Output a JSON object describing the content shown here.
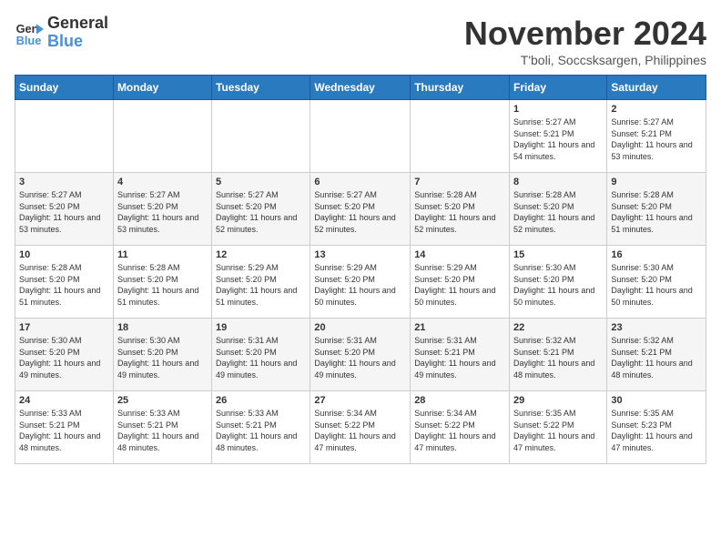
{
  "header": {
    "logo_line1": "General",
    "logo_line2": "Blue",
    "month_title": "November 2024",
    "location": "T'boli, Soccsksargen, Philippines"
  },
  "days_of_week": [
    "Sunday",
    "Monday",
    "Tuesday",
    "Wednesday",
    "Thursday",
    "Friday",
    "Saturday"
  ],
  "weeks": [
    [
      {
        "day": "",
        "info": ""
      },
      {
        "day": "",
        "info": ""
      },
      {
        "day": "",
        "info": ""
      },
      {
        "day": "",
        "info": ""
      },
      {
        "day": "",
        "info": ""
      },
      {
        "day": "1",
        "info": "Sunrise: 5:27 AM\nSunset: 5:21 PM\nDaylight: 11 hours and 54 minutes."
      },
      {
        "day": "2",
        "info": "Sunrise: 5:27 AM\nSunset: 5:21 PM\nDaylight: 11 hours and 53 minutes."
      }
    ],
    [
      {
        "day": "3",
        "info": "Sunrise: 5:27 AM\nSunset: 5:20 PM\nDaylight: 11 hours and 53 minutes."
      },
      {
        "day": "4",
        "info": "Sunrise: 5:27 AM\nSunset: 5:20 PM\nDaylight: 11 hours and 53 minutes."
      },
      {
        "day": "5",
        "info": "Sunrise: 5:27 AM\nSunset: 5:20 PM\nDaylight: 11 hours and 52 minutes."
      },
      {
        "day": "6",
        "info": "Sunrise: 5:27 AM\nSunset: 5:20 PM\nDaylight: 11 hours and 52 minutes."
      },
      {
        "day": "7",
        "info": "Sunrise: 5:28 AM\nSunset: 5:20 PM\nDaylight: 11 hours and 52 minutes."
      },
      {
        "day": "8",
        "info": "Sunrise: 5:28 AM\nSunset: 5:20 PM\nDaylight: 11 hours and 52 minutes."
      },
      {
        "day": "9",
        "info": "Sunrise: 5:28 AM\nSunset: 5:20 PM\nDaylight: 11 hours and 51 minutes."
      }
    ],
    [
      {
        "day": "10",
        "info": "Sunrise: 5:28 AM\nSunset: 5:20 PM\nDaylight: 11 hours and 51 minutes."
      },
      {
        "day": "11",
        "info": "Sunrise: 5:28 AM\nSunset: 5:20 PM\nDaylight: 11 hours and 51 minutes."
      },
      {
        "day": "12",
        "info": "Sunrise: 5:29 AM\nSunset: 5:20 PM\nDaylight: 11 hours and 51 minutes."
      },
      {
        "day": "13",
        "info": "Sunrise: 5:29 AM\nSunset: 5:20 PM\nDaylight: 11 hours and 50 minutes."
      },
      {
        "day": "14",
        "info": "Sunrise: 5:29 AM\nSunset: 5:20 PM\nDaylight: 11 hours and 50 minutes."
      },
      {
        "day": "15",
        "info": "Sunrise: 5:30 AM\nSunset: 5:20 PM\nDaylight: 11 hours and 50 minutes."
      },
      {
        "day": "16",
        "info": "Sunrise: 5:30 AM\nSunset: 5:20 PM\nDaylight: 11 hours and 50 minutes."
      }
    ],
    [
      {
        "day": "17",
        "info": "Sunrise: 5:30 AM\nSunset: 5:20 PM\nDaylight: 11 hours and 49 minutes."
      },
      {
        "day": "18",
        "info": "Sunrise: 5:30 AM\nSunset: 5:20 PM\nDaylight: 11 hours and 49 minutes."
      },
      {
        "day": "19",
        "info": "Sunrise: 5:31 AM\nSunset: 5:20 PM\nDaylight: 11 hours and 49 minutes."
      },
      {
        "day": "20",
        "info": "Sunrise: 5:31 AM\nSunset: 5:20 PM\nDaylight: 11 hours and 49 minutes."
      },
      {
        "day": "21",
        "info": "Sunrise: 5:31 AM\nSunset: 5:21 PM\nDaylight: 11 hours and 49 minutes."
      },
      {
        "day": "22",
        "info": "Sunrise: 5:32 AM\nSunset: 5:21 PM\nDaylight: 11 hours and 48 minutes."
      },
      {
        "day": "23",
        "info": "Sunrise: 5:32 AM\nSunset: 5:21 PM\nDaylight: 11 hours and 48 minutes."
      }
    ],
    [
      {
        "day": "24",
        "info": "Sunrise: 5:33 AM\nSunset: 5:21 PM\nDaylight: 11 hours and 48 minutes."
      },
      {
        "day": "25",
        "info": "Sunrise: 5:33 AM\nSunset: 5:21 PM\nDaylight: 11 hours and 48 minutes."
      },
      {
        "day": "26",
        "info": "Sunrise: 5:33 AM\nSunset: 5:21 PM\nDaylight: 11 hours and 48 minutes."
      },
      {
        "day": "27",
        "info": "Sunrise: 5:34 AM\nSunset: 5:22 PM\nDaylight: 11 hours and 47 minutes."
      },
      {
        "day": "28",
        "info": "Sunrise: 5:34 AM\nSunset: 5:22 PM\nDaylight: 11 hours and 47 minutes."
      },
      {
        "day": "29",
        "info": "Sunrise: 5:35 AM\nSunset: 5:22 PM\nDaylight: 11 hours and 47 minutes."
      },
      {
        "day": "30",
        "info": "Sunrise: 5:35 AM\nSunset: 5:23 PM\nDaylight: 11 hours and 47 minutes."
      }
    ]
  ]
}
